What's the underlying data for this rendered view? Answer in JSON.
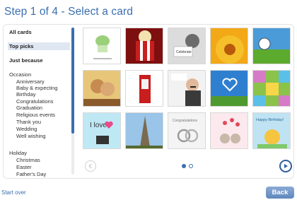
{
  "header": {
    "title": "Step 1 of 4 - Select a card"
  },
  "sidebar": {
    "all_cards": "All cards",
    "top_picks": "Top picks",
    "just_because": "Just because",
    "occasion": {
      "label": "Occasion",
      "items": [
        "Anniversary",
        "Baby & expecting",
        "Birthday",
        "Congratulations",
        "Graduation",
        "Religious events",
        "Thank you",
        "Wedding",
        "Well wishing"
      ]
    },
    "holiday": {
      "label": "Holiday",
      "items": [
        "Christmas",
        "Easter",
        "Father's Day"
      ]
    }
  },
  "cards": [
    {
      "name": "cupcake",
      "caption": "",
      "colors": [
        "#ffffff",
        "#9bd07a"
      ]
    },
    {
      "name": "popcorn",
      "caption": "",
      "colors": [
        "#b01818",
        "#f3e2b0"
      ]
    },
    {
      "name": "celebration-bw",
      "caption": "Celebrate",
      "colors": [
        "#555555",
        "#cfcfcf"
      ]
    },
    {
      "name": "sunflower",
      "caption": "",
      "colors": [
        "#f3a817",
        "#e05c0a"
      ]
    },
    {
      "name": "soccer",
      "caption": "",
      "colors": [
        "#4a9bd8",
        "#5caa2e"
      ]
    },
    {
      "name": "couple",
      "caption": "",
      "colors": [
        "#e7c67a",
        "#c68b4f"
      ]
    },
    {
      "name": "phone-booth",
      "caption": "",
      "colors": [
        "#ffffff",
        "#c81e1e"
      ]
    },
    {
      "name": "mustache-man",
      "caption": "",
      "colors": [
        "#f2f2f2",
        "#3a3a3a"
      ]
    },
    {
      "name": "heart-clouds",
      "caption": "",
      "colors": [
        "#2f7fd0",
        "#4f9a30"
      ]
    },
    {
      "name": "pattern",
      "caption": "",
      "colors": [
        "#8bc34a",
        "#d77ac8"
      ]
    },
    {
      "name": "i-love-you",
      "caption": "I love",
      "colors": [
        "#bfe8f5",
        "#e84b8a"
      ]
    },
    {
      "name": "eiffel-tower",
      "caption": "",
      "colors": [
        "#9ac4e8",
        "#7a6a50"
      ]
    },
    {
      "name": "rings",
      "caption": "Congratulations",
      "colors": [
        "#f4f4f4",
        "#9a9a9a"
      ]
    },
    {
      "name": "mice-hearts",
      "caption": "",
      "colors": [
        "#fbe9ee",
        "#e04a5a"
      ]
    },
    {
      "name": "happy-birthday",
      "caption": "Happy Birthday!",
      "colors": [
        "#bfe3f2",
        "#f5c542"
      ]
    }
  ],
  "pagination": {
    "current_page": 1,
    "total_pages": 2
  },
  "footer": {
    "start_over": "Start over",
    "back": "Back"
  },
  "colors": {
    "accent": "#3a6fb0",
    "scroll_thumb": "#3a6fb0"
  }
}
